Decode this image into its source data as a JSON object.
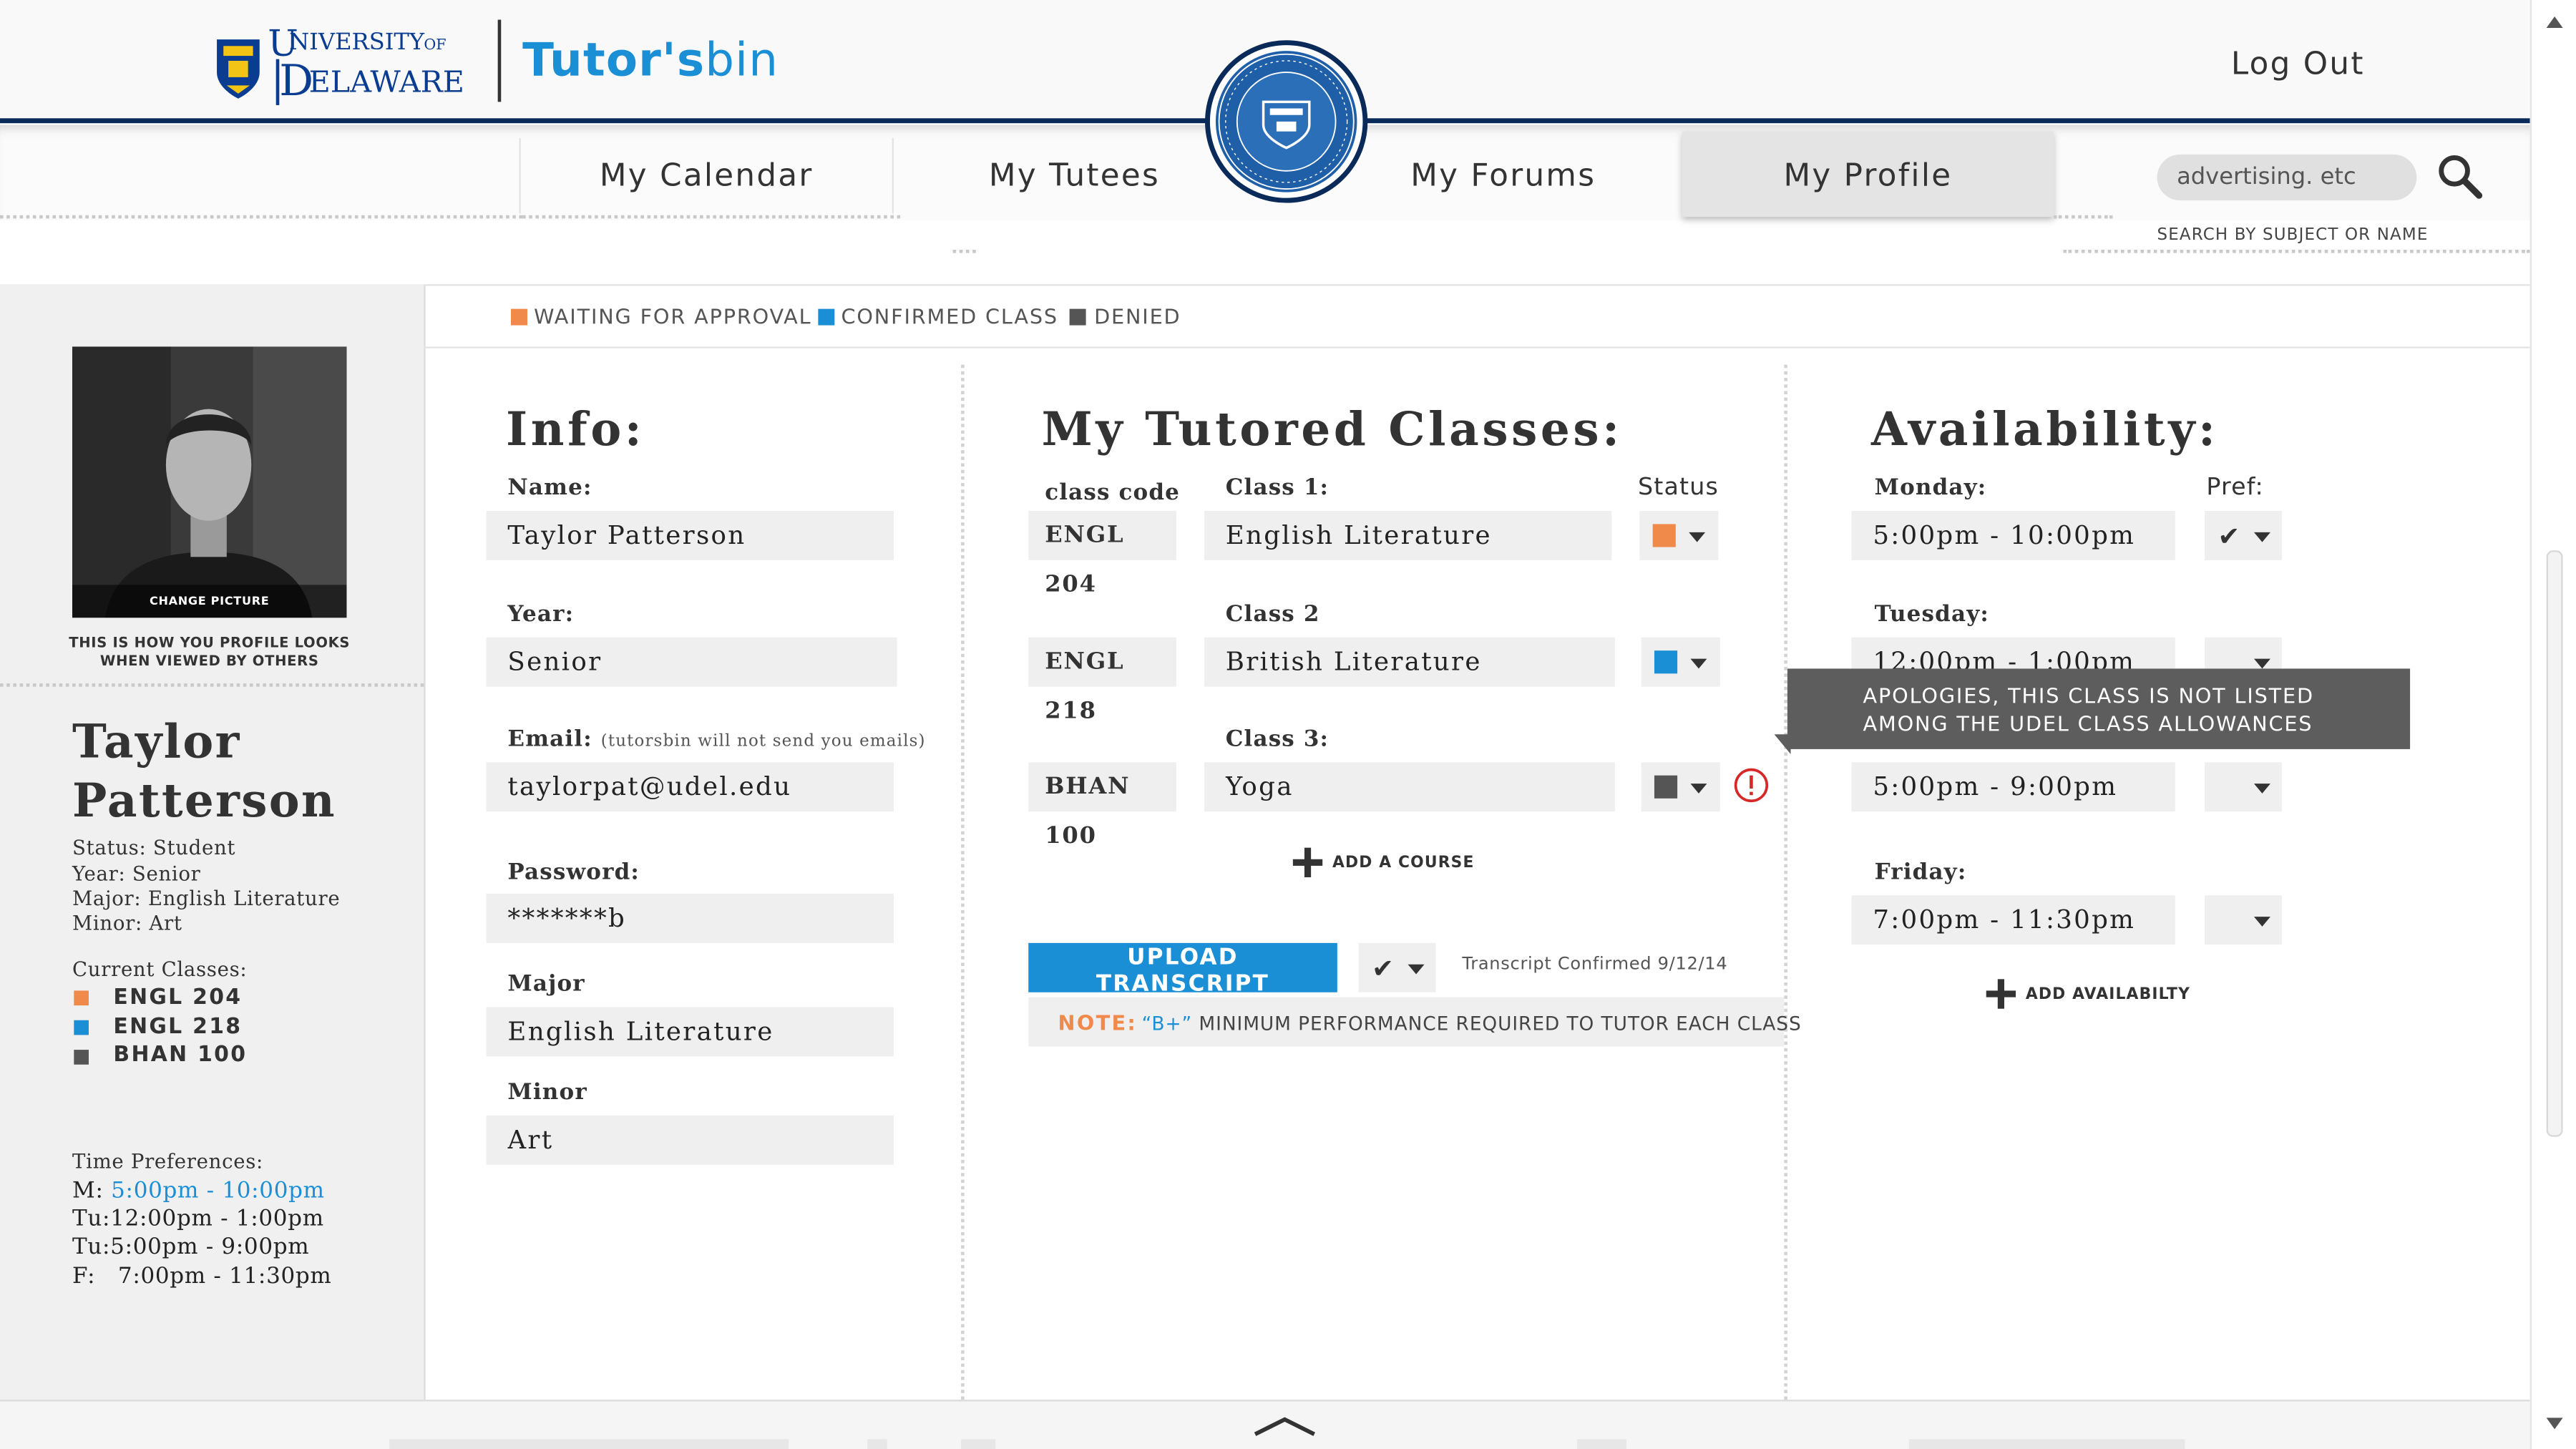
{
  "header": {
    "ud_logo_text": "UNIVERSITY OF DELAWARE",
    "brand_name": "Tutor's",
    "brand_suffix": "bin",
    "logout_label": "Log Out"
  },
  "nav": {
    "tabs": [
      {
        "label": "My Calendar"
      },
      {
        "label": "My Tutees"
      },
      {
        "label": "My Forums"
      },
      {
        "label": "My Profile",
        "active": true
      }
    ]
  },
  "search": {
    "value": "advertising. etc",
    "caption": "SEARCH BY SUBJECT OR NAME"
  },
  "legend": {
    "items": [
      {
        "label": "WAITING FOR APPROVAL",
        "color": "#f08a4b"
      },
      {
        "label": "CONFIRMED CLASS",
        "color": "#1a8fd6"
      },
      {
        "label": "DENIED",
        "color": "#555555"
      }
    ]
  },
  "sidebar": {
    "change_picture": "CHANGE PICTURE",
    "profile_note_line1": "THIS IS HOW YOU PROFILE LOOKS",
    "profile_note_line2": "WHEN VIEWED BY OTHERS",
    "name_first": "Taylor",
    "name_last": "Patterson",
    "status": "Status: Student",
    "year": "Year: Senior",
    "major": "Major: English Literature",
    "minor": "Minor: Art",
    "current_classes_label": "Current Classes:",
    "current_classes": [
      {
        "code": "ENGL 204",
        "color": "#f08a4b"
      },
      {
        "code": "ENGL 218",
        "color": "#1a8fd6"
      },
      {
        "code": "BHAN 100",
        "color": "#555555"
      }
    ],
    "time_pref_label": "Time Preferences:",
    "time_prefs": [
      {
        "day": "M:",
        "time": "5:00pm - 10:00pm",
        "highlight": true
      },
      {
        "day": "Tu:",
        "time": "12:00pm - 1:00pm"
      },
      {
        "day": "Tu:",
        "time": "5:00pm - 9:00pm"
      },
      {
        "day": "F:",
        "time": "7:00pm - 11:30pm"
      }
    ]
  },
  "info": {
    "title": "Info:",
    "name_label": "Name:",
    "name_value": "Taylor Patterson",
    "year_label": "Year:",
    "year_value": "Senior",
    "email_label": "Email:",
    "email_note": "(tutorsbin will not send you emails)",
    "email_value": "taylorpat@udel.edu",
    "password_label": "Password:",
    "password_value": "*******b",
    "major_label": "Major",
    "major_value": "English Literature",
    "minor_label": "Minor",
    "minor_value": "Art"
  },
  "classes": {
    "title": "My Tutored Classes:",
    "code_header": "class code",
    "status_header": "Status",
    "rows": [
      {
        "label": "Class 1:",
        "code": "ENGL 204",
        "name": "English Literature",
        "status_color": "#f08a4b"
      },
      {
        "label": "Class 2",
        "code": "ENGL 218",
        "name": "British Literature",
        "status_color": "#1a8fd6"
      },
      {
        "label": "Class 3:",
        "code": "BHAN 100",
        "name": "Yoga",
        "status_color": "#555555"
      }
    ],
    "add_course": "ADD A COURSE",
    "upload_label": "UPLOAD TRANSCRIPT",
    "transcript_status": "Transcript Confirmed 9/12/14",
    "note_label": "NOTE:",
    "note_grade": "“B+”",
    "note_text": "MINIMUM PERFORMANCE REQUIRED TO TUTOR EACH CLASS"
  },
  "tooltip": {
    "line1": "APOLOGIES, THIS CLASS IS NOT LISTED",
    "line2": "AMONG THE UDEL CLASS ALLOWANCES"
  },
  "availability": {
    "title": "Availability:",
    "pref_header": "Pref:",
    "rows": [
      {
        "day": "Monday:",
        "time": "5:00pm - 10:00pm"
      },
      {
        "day": "Tuesday:",
        "time": "12:00pm - 1:00pm"
      },
      {
        "day": "",
        "time": "5:00pm - 9:00pm"
      },
      {
        "day": "Friday:",
        "time": "7:00pm - 11:30pm"
      }
    ],
    "add_availability": "ADD AVAILABILTY"
  },
  "colors": {
    "accent": "#1a8fd6",
    "navy": "#0a2a5a",
    "waiting": "#f08a4b",
    "denied": "#555555",
    "error": "#d62828"
  }
}
